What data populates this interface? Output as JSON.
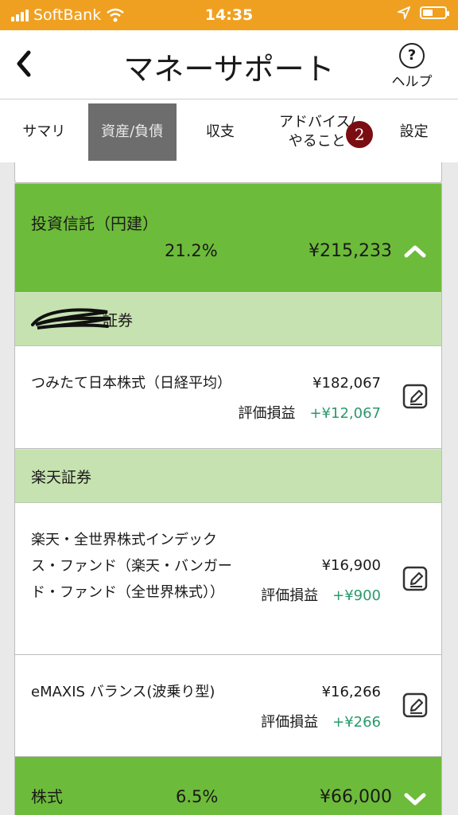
{
  "status_bar": {
    "carrier": "SoftBank",
    "time": "14:35"
  },
  "header": {
    "title": "マネーサポート",
    "help_label": "ヘルプ",
    "help_symbol": "?"
  },
  "tabs": [
    {
      "label": "サマリ"
    },
    {
      "label": "資産/負債",
      "active": true
    },
    {
      "label": "収支"
    },
    {
      "label": "アドバイス/やること",
      "badge": "2"
    },
    {
      "label": "設定"
    }
  ],
  "category": {
    "name": "投資信託（円建）",
    "percent": "21.2%",
    "amount": "¥215,233"
  },
  "brokers": [
    {
      "name": "証券",
      "funds": [
        {
          "name": "つみたて日本株式（日経平均）",
          "value": "¥182,067",
          "gain_label": "評価損益",
          "gain": "+¥12,067"
        }
      ]
    },
    {
      "name": "楽天証券",
      "funds": [
        {
          "name": "楽天・全世界株式インデックス・ファンド（楽天・バンガード・ファンド（全世界株式））",
          "value": "¥16,900",
          "gain_label": "評価損益",
          "gain": "+¥900"
        },
        {
          "name": "eMAXIS バランス(波乗り型)",
          "value": "¥16,266",
          "gain_label": "評価損益",
          "gain": "+¥266"
        }
      ]
    }
  ],
  "category2": {
    "name": "株式",
    "percent": "6.5%",
    "amount": "¥66,000"
  },
  "colors": {
    "status_bar": "#f0a020",
    "category_header": "#6dbb3a",
    "broker_header": "#c6e2b0",
    "gain": "#2a9a6a",
    "badge": "#7a0d12"
  }
}
